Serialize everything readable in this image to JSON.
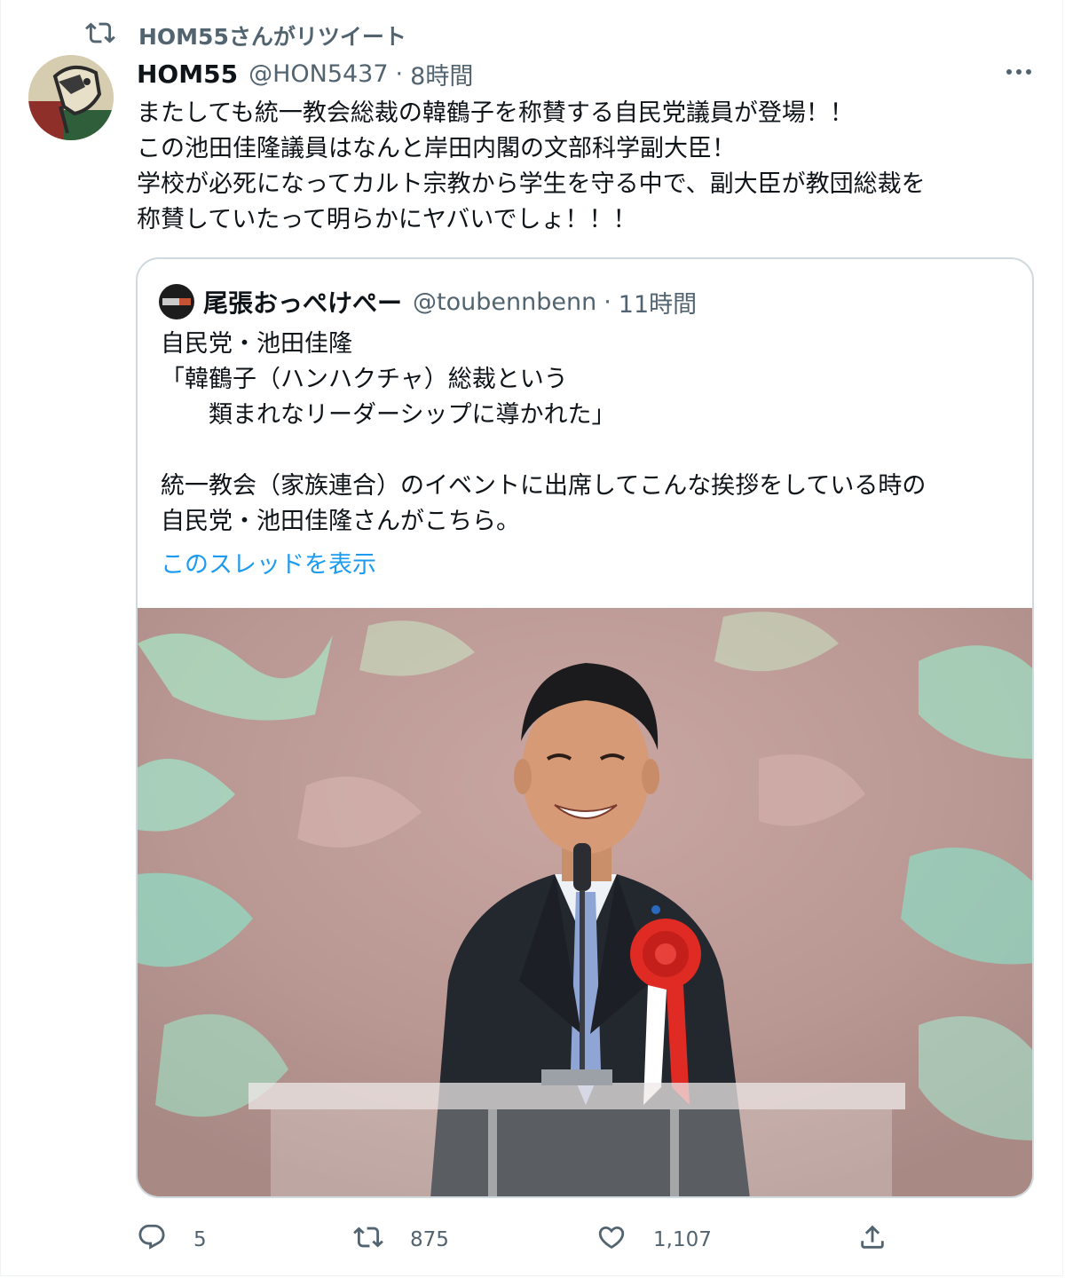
{
  "retweet_context": {
    "icon": "retweet-icon",
    "label": "HOM55さんがリツイート"
  },
  "tweet": {
    "display_name": "HOM55",
    "handle": "@HON5437",
    "separator": "·",
    "time": "8時間",
    "more_icon": "more-icon",
    "lines": [
      "またしても統一教会総裁の韓鶴子を称賛する自民党議員が登場！！",
      "この池田佳隆議員はなんと岸田内閣の文部科学副大臣！",
      "学校が必死になってカルト宗教から学生を守る中で、副大臣が教団総裁を",
      "称賛していたって明らかにヤバいでしょ！！！"
    ]
  },
  "quote": {
    "display_name": "尾張おっぺけぺー",
    "handle": "@toubennbenn",
    "separator": "·",
    "time": "11時間",
    "lines": [
      "自民党・池田佳隆",
      "「韓鶴子（ハンハクチャ）総裁という",
      "　　類まれなリーダーシップに導かれた」",
      "",
      "統一教会（家族連合）のイベントに出席してこんな挨拶をしている時の",
      "自民党・池田佳隆さんがこちら。"
    ],
    "show_thread": "このスレッドを表示"
  },
  "actions": {
    "reply": {
      "icon": "reply-icon",
      "count": "5"
    },
    "retweet": {
      "icon": "retweet-icon",
      "count": "875"
    },
    "like": {
      "icon": "heart-icon",
      "count": "1,107"
    },
    "share": {
      "icon": "share-icon"
    }
  },
  "colors": {
    "text": "#0f1419",
    "secondary": "#536471",
    "link": "#1d9bf0",
    "border": "#cfd9de"
  }
}
